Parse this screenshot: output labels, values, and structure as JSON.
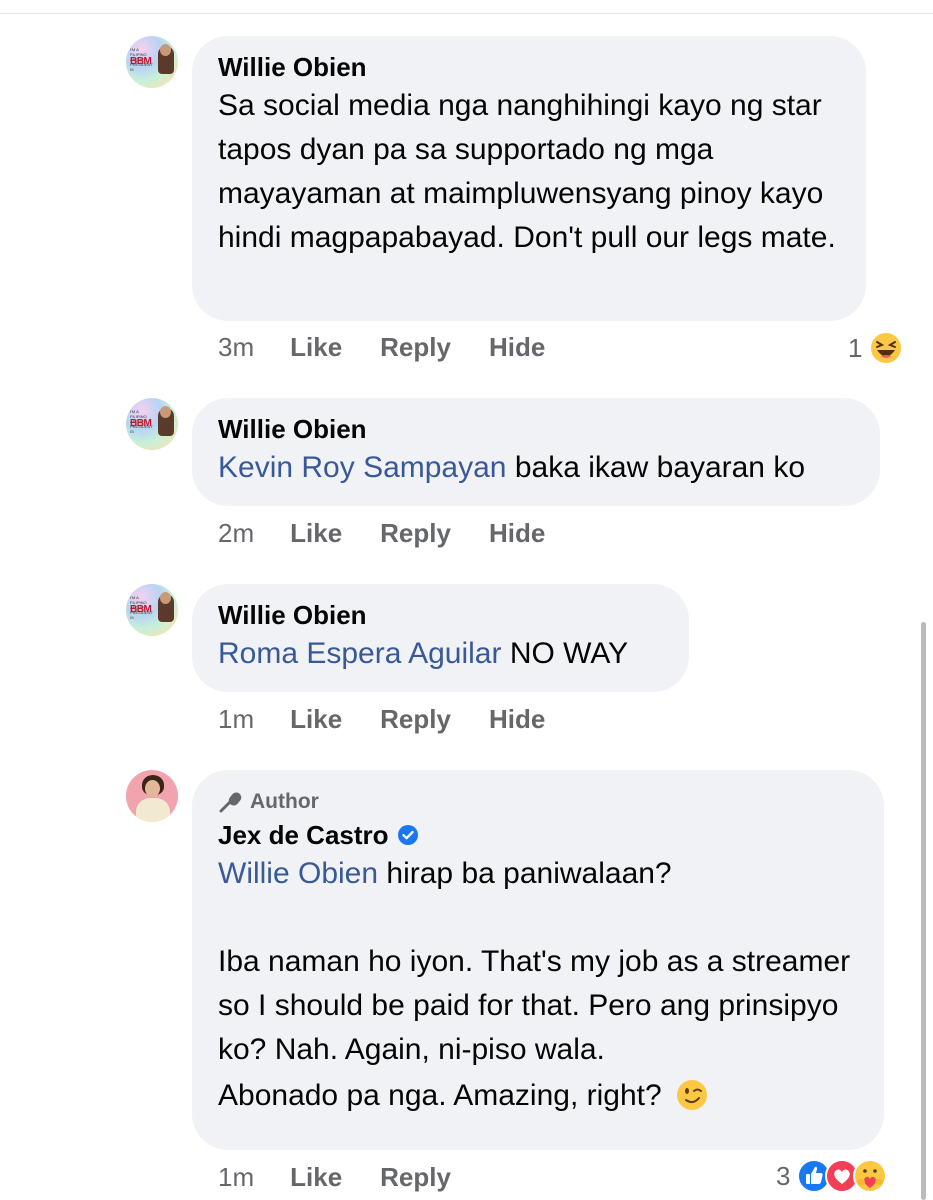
{
  "comments": [
    {
      "name": "Willie Obien",
      "text": "Sa social media nga nanghihingi kayo ng star tapos dyan pa sa supportado ng mga mayayaman at maimpluwensyang pinoy kayo hindi magpapabayad. Don't pull our legs mate.",
      "time": "3m",
      "like": "Like",
      "reply": "Reply",
      "hide": "Hide",
      "reaction_count": "1",
      "reactions": [
        "haha-icon"
      ]
    },
    {
      "name": "Willie Obien",
      "mention": "Kevin Roy Sampayan",
      "text": " baka ikaw bayaran ko",
      "time": "2m",
      "like": "Like",
      "reply": "Reply",
      "hide": "Hide"
    },
    {
      "name": "Willie Obien",
      "mention": "Roma Espera Aguilar",
      "text": " NO WAY",
      "time": "1m",
      "like": "Like",
      "reply": "Reply",
      "hide": "Hide"
    },
    {
      "badge": "Author",
      "name": "Jex de Castro",
      "mention": "Willie Obien",
      "text_line1": " hirap ba paniwalaan?",
      "paragraph2": "Iba naman ho iyon. That's my job as a streamer so I should be paid for that. Pero ang prinsipyo ko? Nah. Again, ni-piso wala.",
      "paragraph3": "Abonado pa nga. Amazing, right?",
      "time": "1m",
      "like": "Like",
      "reply": "Reply",
      "reaction_count": "3",
      "reactions": [
        "like-icon",
        "love-icon",
        "care-icon"
      ]
    }
  ],
  "avatar_text": {
    "bbm_small": "I'M A FILIPINO AND MY PRESIDENT IS",
    "bbm": "BBM"
  },
  "colors": {
    "bubble": "#f0f2f5",
    "mention": "#385898",
    "meta": "#65676b",
    "verified": "#1877f2"
  }
}
